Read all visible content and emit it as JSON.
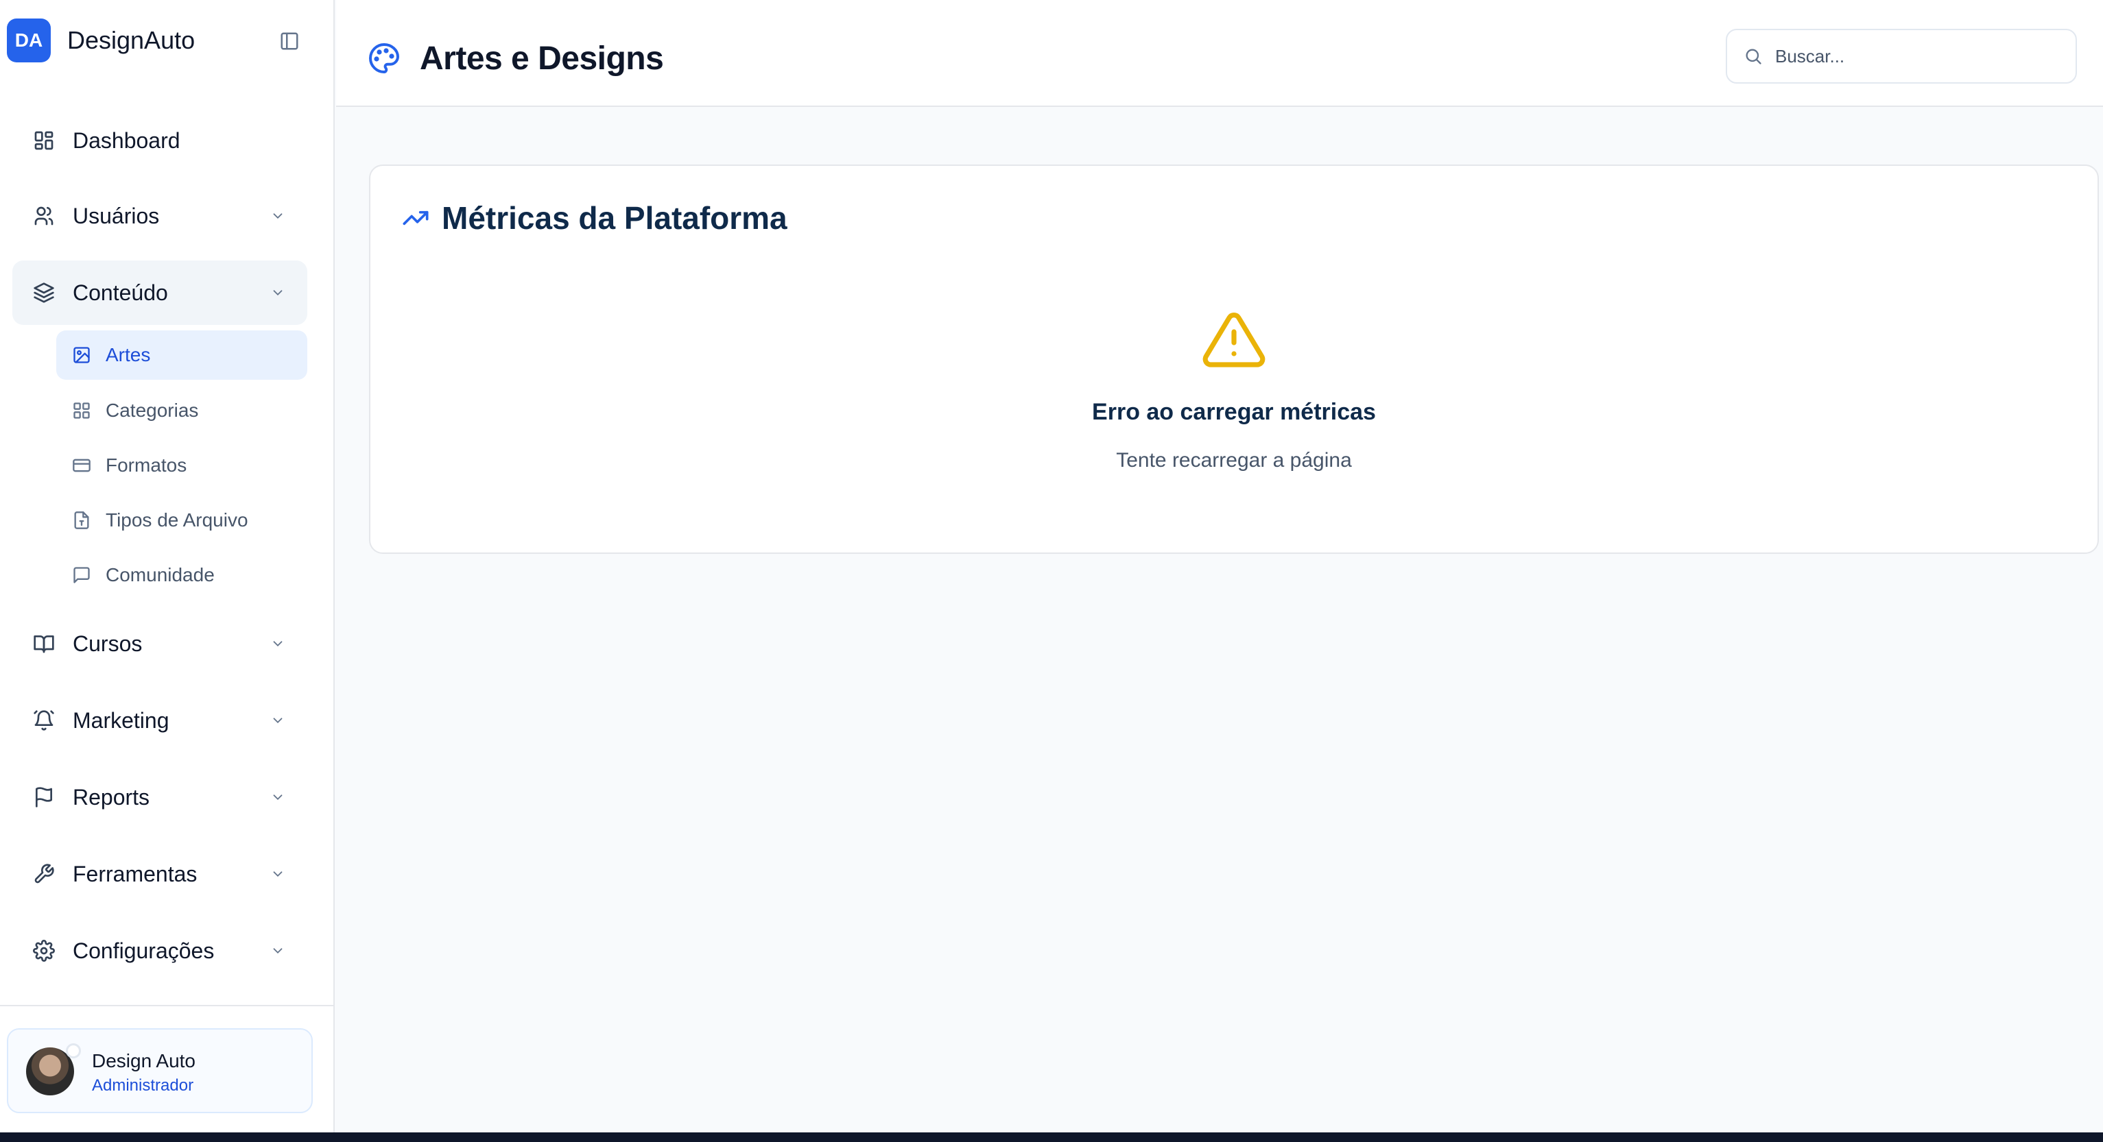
{
  "brand": {
    "logo_text": "DA",
    "name": "DesignAuto"
  },
  "nav": {
    "items": [
      {
        "label": "Dashboard",
        "icon": "grid-icon"
      },
      {
        "label": "Usuários",
        "icon": "users-icon"
      },
      {
        "label": "Conteúdo",
        "icon": "layers-icon"
      },
      {
        "label": "Cursos",
        "icon": "book-icon"
      },
      {
        "label": "Marketing",
        "icon": "bell-icon"
      },
      {
        "label": "Reports",
        "icon": "flag-icon"
      },
      {
        "label": "Ferramentas",
        "icon": "wrench-icon"
      },
      {
        "label": "Configurações",
        "icon": "gear-icon"
      }
    ],
    "content_sub": [
      {
        "label": "Artes",
        "icon": "image-icon",
        "active": true
      },
      {
        "label": "Categorias",
        "icon": "grid-icon"
      },
      {
        "label": "Formatos",
        "icon": "card-icon"
      },
      {
        "label": "Tipos de Arquivo",
        "icon": "file-icon"
      },
      {
        "label": "Comunidade",
        "icon": "message-icon"
      }
    ]
  },
  "user": {
    "name": "Design Auto",
    "role": "Administrador"
  },
  "header": {
    "title": "Artes e Designs",
    "title_icon": "palette-icon"
  },
  "search": {
    "placeholder": "Buscar..."
  },
  "metrics_card": {
    "title": "Métricas da Plataforma",
    "error_title": "Erro ao carregar métricas",
    "error_subtitle": "Tente recarregar a página"
  },
  "colors": {
    "accent": "#2563eb",
    "warning": "#eab308",
    "active_bg": "#e8f1fe"
  }
}
